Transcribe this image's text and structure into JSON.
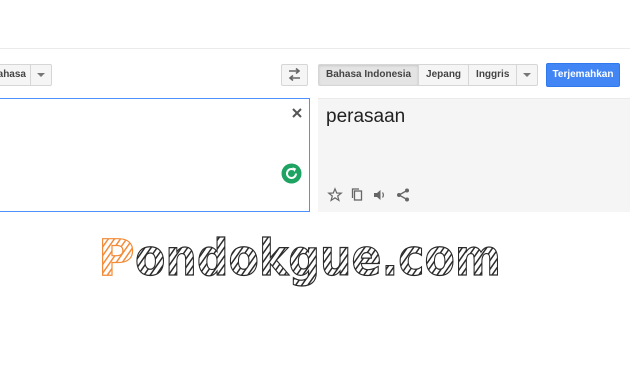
{
  "source": {
    "language_label": "ahasa",
    "clear_icon": "close-icon",
    "refresh_icon": "refresh-icon"
  },
  "target": {
    "languages": [
      "Bahasa Indonesia",
      "Jepang",
      "Inggris"
    ],
    "selected": "Bahasa Indonesia",
    "translate_label": "Terjemahkan",
    "result_text": "perasaan",
    "tools": [
      "star-icon",
      "copy-icon",
      "speaker-icon",
      "share-icon"
    ]
  },
  "watermark": {
    "first_letter": "P",
    "rest": "ondokgue.com"
  },
  "colors": {
    "accent": "#4285f4",
    "refresh_green": "#1ea362",
    "watermark_orange": "#f28c3a",
    "watermark_dark": "#2b2b2b"
  }
}
